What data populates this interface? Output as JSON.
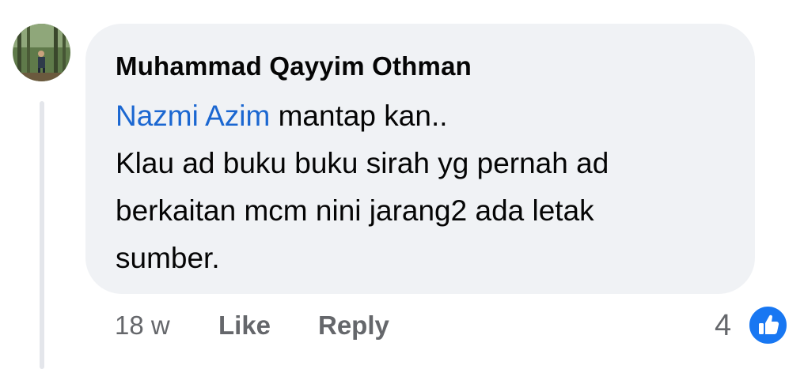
{
  "comment": {
    "author": "Muhammad Qayyim Othman",
    "mention": "Nazmi Azim",
    "body_line1_rest": " mantap kan..",
    "body_line2": "Klau ad buku buku sirah yg pernah ad",
    "body_line3": "berkaitan mcm nini jarang2 ada letak",
    "body_line4": "sumber."
  },
  "actions": {
    "timestamp": "18 w",
    "like_label": "Like",
    "reply_label": "Reply",
    "reaction_count": "4"
  },
  "icons": {
    "avatar": "profile-photo-forest",
    "reaction": "thumbs-up-icon"
  },
  "colors": {
    "mention": "#1b67d1",
    "bubble": "#f0f2f5",
    "meta_text": "#65676b",
    "like_badge": "#1877f2"
  }
}
